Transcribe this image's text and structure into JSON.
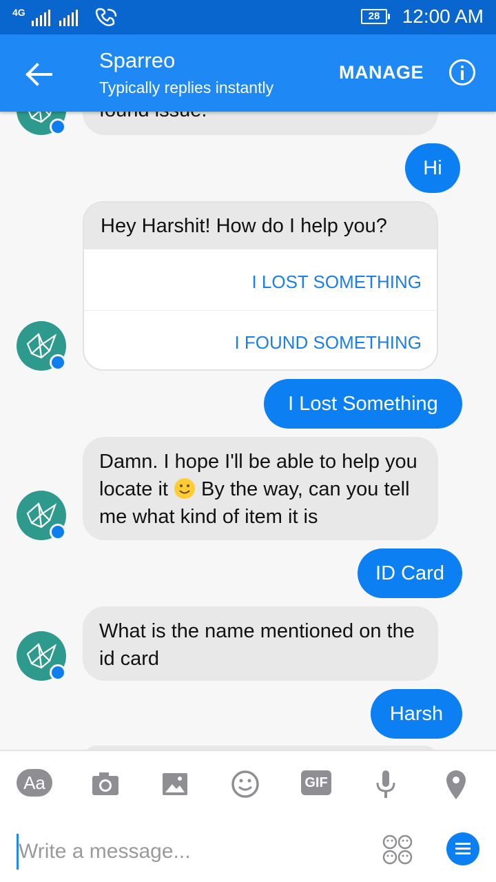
{
  "status_bar": {
    "network": "4G",
    "battery": "28",
    "time": "12:00 AM"
  },
  "header": {
    "title": "Sparreo",
    "subtitle": "Typically replies instantly",
    "manage_label": "MANAGE"
  },
  "messages": {
    "m0_partial": "found issue.",
    "m1_user": "Hi",
    "m2_card_text": "Hey Harshit! How do I help you?",
    "m2_option1": "I LOST SOMETHING",
    "m2_option2": "I FOUND SOMETHING",
    "m3_user": "I Lost Something",
    "m4_bot_part1": "Damn. I hope I'll be able to help you locate it ",
    "m4_bot_part2": " By the way, can you tell me what kind of item it is",
    "m5_user": "ID Card",
    "m6_bot": "What is the name mentioned on the id card",
    "m7_user": "Harsh"
  },
  "composer": {
    "aa_label": "Aa",
    "gif_label": "GIF",
    "placeholder": "Write a message..."
  },
  "icons": [
    "back-arrow-icon",
    "info-icon",
    "camera-icon",
    "image-icon",
    "emoji-icon",
    "microphone-icon",
    "location-pin-icon",
    "stickers-icon",
    "menu-icon",
    "messenger-badge-icon",
    "bot-logo-icon"
  ],
  "colors": {
    "header": "#1e88f5",
    "status_bar": "#0a66cf",
    "user_bubble": "#0c7ff2",
    "bot_bubble": "#e8e8e8",
    "avatar": "#2e9a8e"
  }
}
